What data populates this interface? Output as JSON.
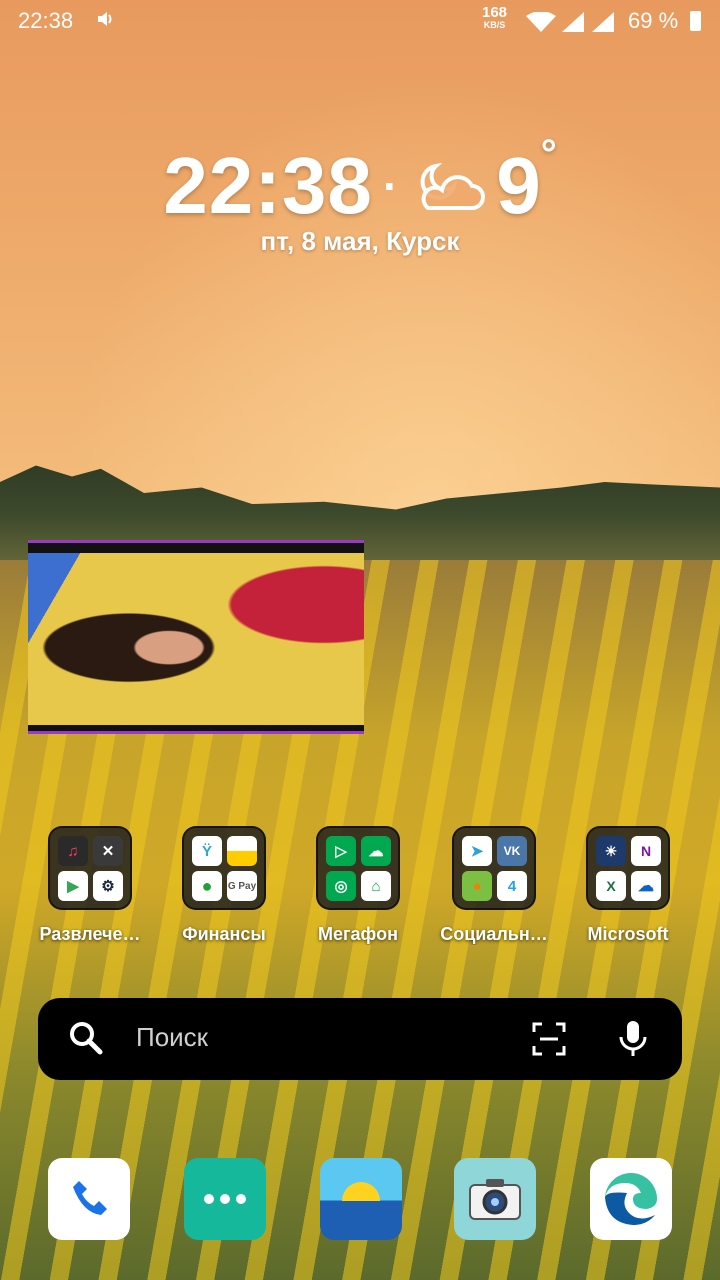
{
  "status": {
    "time": "22:38",
    "net_speed": "168",
    "net_unit": "KB/S",
    "battery": "69 %"
  },
  "clock_widget": {
    "time": "22:38",
    "separator": "·",
    "temperature": "9",
    "degree": "°",
    "date_location": "пт, 8 мая, Курск",
    "weather_icon": "partly-cloudy-night-icon"
  },
  "video": {
    "name": "picture-in-picture-video"
  },
  "folders": [
    {
      "label": "Развлече…",
      "apps": [
        "music-icon",
        "editor-icon",
        "play-store-icon",
        "steam-icon"
      ]
    },
    {
      "label": "Финансы",
      "apps": [
        "yota-icon",
        "yandex-money-icon",
        "sberbank-icon",
        "google-pay-icon"
      ]
    },
    {
      "label": "Мегафон",
      "apps": [
        "megafon-tv-icon",
        "megafon-cloud-icon",
        "megafon-browser-icon",
        "megafon-home-icon"
      ]
    },
    {
      "label": "Социальн…",
      "apps": [
        "telegram-icon",
        "vk-icon",
        "ok-icon",
        "icq-icon"
      ]
    },
    {
      "label": "Microsoft",
      "apps": [
        "msn-weather-icon",
        "onenote-icon",
        "excel-icon",
        "onedrive-icon"
      ]
    }
  ],
  "search": {
    "placeholder": "Поиск"
  },
  "dock": {
    "apps": [
      "phone-icon",
      "app-drawer-icon",
      "weather-app-icon",
      "camera-icon",
      "edge-icon"
    ]
  },
  "colors": {
    "accent_purple": "#9b39c8",
    "search_bg": "#000000"
  }
}
